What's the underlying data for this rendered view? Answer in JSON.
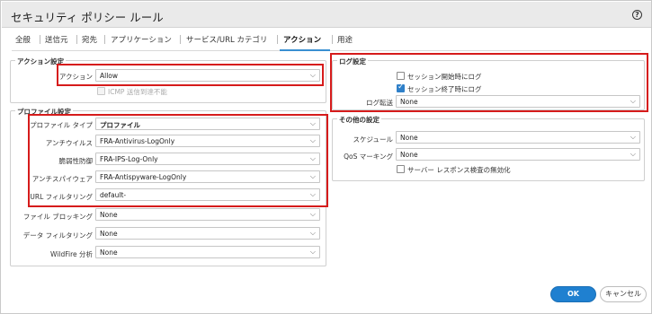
{
  "dialog": {
    "title": "セキュリティ ポリシー ルール",
    "help_symbol": "?"
  },
  "tabs": [
    {
      "label": "全般"
    },
    {
      "label": "送信元"
    },
    {
      "label": "宛先"
    },
    {
      "label": "アプリケーション"
    },
    {
      "label": "サービス/URL カテゴリ"
    },
    {
      "label": "アクション",
      "active": true
    },
    {
      "label": "用途"
    }
  ],
  "action_settings": {
    "legend": "アクション設定",
    "action_label": "アクション",
    "action_value": "Allow",
    "icmp_label": "ICMP 送信到達不能",
    "icmp_checked": false
  },
  "profile_settings": {
    "legend": "プロファイル設定",
    "rows": [
      {
        "label": "プロファイル タイプ",
        "value": "プロファイル"
      },
      {
        "label": "アンチウイルス",
        "value": "FRA-Antivirus-LogOnly"
      },
      {
        "label": "脆弱性防御",
        "value": "FRA-IPS-Log-Only"
      },
      {
        "label": "アンチスパイウェア",
        "value": "FRA-Antispyware-LogOnly"
      },
      {
        "label": "URL フィルタリング",
        "value": "default-"
      },
      {
        "label": "ファイル ブロッキング",
        "value": "None"
      },
      {
        "label": "データ フィルタリング",
        "value": "None"
      },
      {
        "label": "WildFire 分析",
        "value": "None"
      }
    ]
  },
  "log_settings": {
    "legend": "ログ設定",
    "log_start_label": "セッション開始時にログ",
    "log_start_checked": false,
    "log_end_label": "セッション終了時にログ",
    "log_end_checked": true,
    "forwarding_label": "ログ転送",
    "forwarding_value": "None"
  },
  "other_settings": {
    "legend": "その他の設定",
    "schedule_label": "スケジュール",
    "schedule_value": "None",
    "qos_label": "QoS マーキング",
    "qos_value": "None",
    "disable_inspection_label": "サーバー レスポンス検査の無効化",
    "disable_inspection_checked": false
  },
  "buttons": {
    "ok": "OK",
    "cancel": "キャンセル"
  },
  "colors": {
    "highlight": "#d61b1b",
    "accent": "#1f80d0"
  }
}
